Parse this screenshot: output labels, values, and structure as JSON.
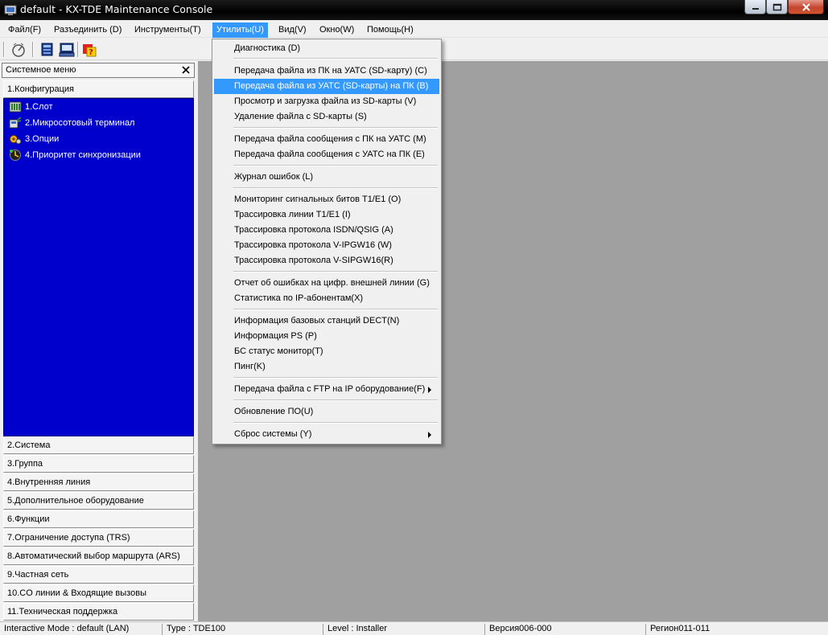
{
  "window": {
    "title": "default - KX-TDE Maintenance Console"
  },
  "menubar": {
    "items": [
      {
        "label": "Файл(F)"
      },
      {
        "label": "Разъединить (D)"
      },
      {
        "label": "Инструменты(T)"
      },
      {
        "label": "Утилиты(U)"
      },
      {
        "label": "Вид(V)"
      },
      {
        "label": "Окно(W)"
      },
      {
        "label": "Помощь(H)"
      }
    ],
    "active": "Утилиты(U)"
  },
  "toolbar": {
    "icons": [
      "connect-icon",
      "system-icon",
      "terminal-icon",
      "help-icon"
    ]
  },
  "utilities_menu": {
    "items": [
      {
        "label": "Диагностика (D)"
      },
      {
        "label": "Передача файла из ПК на УАТС (SD-карту) (C)"
      },
      {
        "label": "Передача файла из УАТС (SD-карты) на ПК (B)",
        "highlighted": true
      },
      {
        "label": "Просмотр и загрузка файла из SD-карты (V)"
      },
      {
        "label": "Удаление файла с SD-карты (S)"
      },
      {
        "label": "Передача файла сообщения с ПК на УАТС (M)"
      },
      {
        "label": "Передача файла сообщения с УАТС на ПК (E)"
      },
      {
        "label": "Журнал ошибок (L)"
      },
      {
        "label": "Мониторинг сигнальных битов T1/E1 (O)"
      },
      {
        "label": "Трассировка линии T1/E1 (I)"
      },
      {
        "label": "Трассировка протокола ISDN/QSIG (A)"
      },
      {
        "label": "Трассировка протокола V-IPGW16 (W)"
      },
      {
        "label": "Трассировка протокола V-SIPGW16(R)"
      },
      {
        "label": "Отчет об ошибках на цифр. внешней линии (G)"
      },
      {
        "label": "Статистика по IP-абонентам(X)"
      },
      {
        "label": "Информация базовых станций DECT(N)"
      },
      {
        "label": "Информация PS (P)"
      },
      {
        "label": "БС статус монитор(T)"
      },
      {
        "label": "Пинг(K)"
      },
      {
        "label": "Передача файла с FTP на IP оборудование(F)",
        "submenu": true
      },
      {
        "label": "Обновление ПО(U)"
      },
      {
        "label": "Сброс системы (Y)",
        "submenu": true
      }
    ]
  },
  "sidepanel": {
    "title": "Системное меню",
    "active_category": "1.Конфигурация",
    "tree_items": [
      {
        "label": "1.Слот",
        "icon": "slot-icon"
      },
      {
        "label": "2.Микросотовый терминал",
        "icon": "cell-terminal-icon"
      },
      {
        "label": "3.Опции",
        "icon": "options-icon"
      },
      {
        "label": "4.Приоритет синхронизации",
        "icon": "sync-priority-icon"
      }
    ],
    "categories": [
      {
        "label": "2.Система"
      },
      {
        "label": "3.Группа"
      },
      {
        "label": "4.Внутренняя линия"
      },
      {
        "label": "5.Дополнительное оборудование"
      },
      {
        "label": "6.Функции"
      },
      {
        "label": "7.Ограничение доступа (TRS)"
      },
      {
        "label": "8.Автоматический выбор маршрута (ARS)"
      },
      {
        "label": "9.Частная сеть"
      },
      {
        "label": "10.CO линии & Входящие вызовы"
      },
      {
        "label": "11.Техническая поддержка"
      }
    ]
  },
  "statusbar": {
    "mode": "Interactive Mode : default (LAN)",
    "type": "Type : TDE100",
    "level": "Level : Installer",
    "version": "Версия006-000",
    "region": "Регион011-011"
  }
}
